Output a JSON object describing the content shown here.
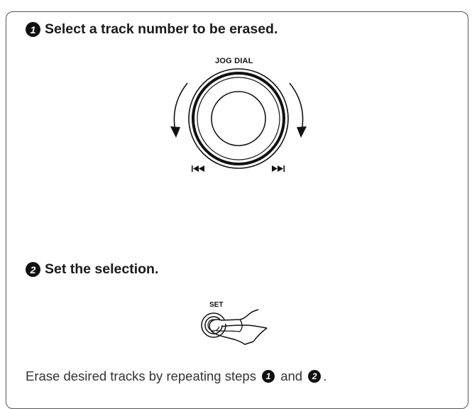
{
  "step1": {
    "number": "1",
    "title": "Select a track number to be erased."
  },
  "jog_dial": {
    "label": "JOG DIAL",
    "icons": [
      "rotate-counterclockwise-arrow-icon",
      "rotate-clockwise-arrow-icon",
      "skip-previous-icon",
      "skip-next-icon"
    ]
  },
  "step2": {
    "number": "2",
    "title": "Set the selection."
  },
  "set_button": {
    "label": "SET",
    "icons": [
      "pressing-hand-icon"
    ]
  },
  "footer": {
    "text_before": "Erase desired tracks by repeating steps ",
    "ref1": "1",
    "text_middle": " and ",
    "ref2": "2",
    "text_after": "."
  }
}
